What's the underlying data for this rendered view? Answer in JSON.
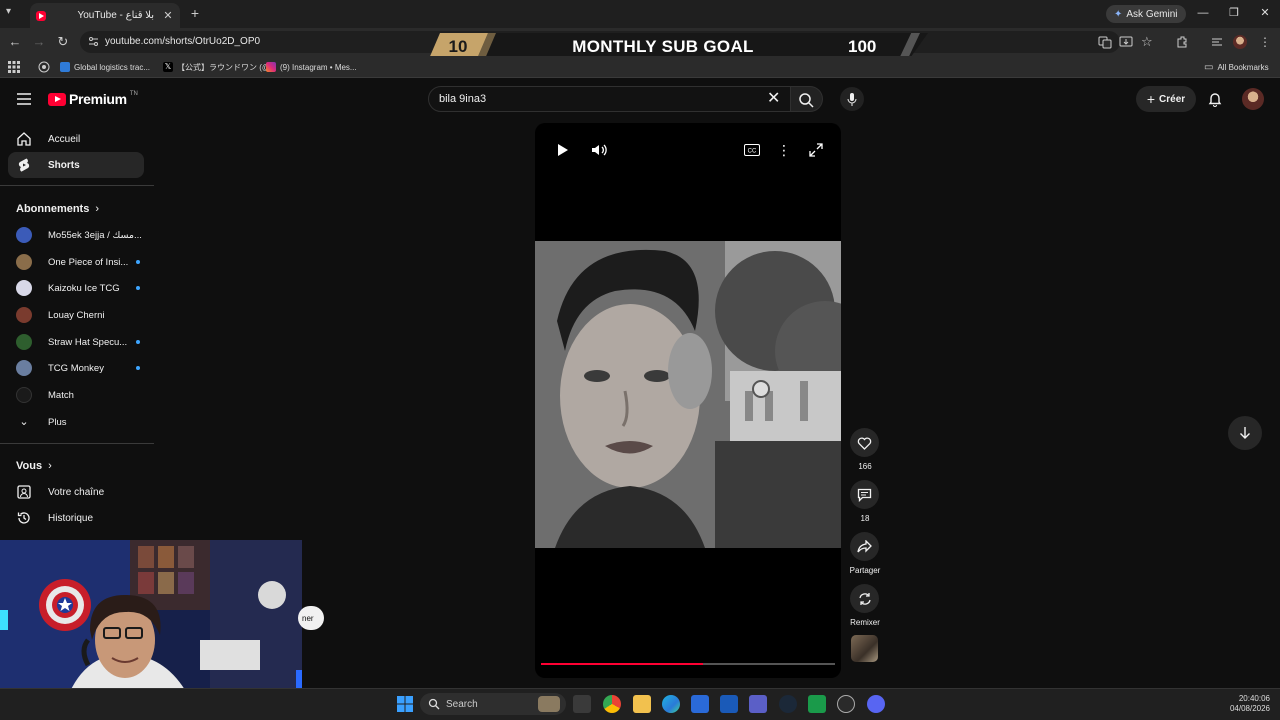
{
  "browser": {
    "tab_title": "YouTube - بلا قناع",
    "tab_close": "✕",
    "new_tab": "+",
    "ask_gemini": "Ask Gemini",
    "url": "youtube.com/shorts/OtrUo2D_OP0",
    "window_controls": [
      "—",
      "❐",
      "✕"
    ],
    "bookmarks": [
      {
        "label": "Global logistics trac...",
        "icon_color": "#2f7bd8"
      },
      {
        "label": "【公式】ラウンドワン (@...",
        "icon_color": "#000000"
      },
      {
        "label": "(9) Instagram • Mes...",
        "icon_color": "#d6249f"
      }
    ],
    "all_bookmarks": "All Bookmarks"
  },
  "overlay": {
    "current": "10",
    "label": "MONTHLY SUB GOAL",
    "target": "100",
    "accent": "#c6a46a"
  },
  "youtube": {
    "logo_text": "Premium",
    "logo_tm": "TN",
    "search_value": "bila 9ina3",
    "create_label": "Créer"
  },
  "sidebar": {
    "main": [
      {
        "label": "Accueil",
        "icon": "home-icon"
      },
      {
        "label": "Shorts",
        "icon": "shorts-icon",
        "active": true
      }
    ],
    "subscriptions_title": "Abonnements",
    "subscriptions": [
      {
        "name": "Mo55ek 3ejja / مسك...",
        "color": "#3b5bb8",
        "dot": false
      },
      {
        "name": "One Piece of Insi...",
        "color": "#8a6d4a",
        "dot": true
      },
      {
        "name": "Kaizoku Ice TCG",
        "color": "#d8d8e8",
        "dot": true
      },
      {
        "name": "Louay Cherni",
        "color": "#7a3b2e",
        "dot": false
      },
      {
        "name": "Straw Hat Specu...",
        "color": "#2e5e2e",
        "dot": true
      },
      {
        "name": "TCG Monkey",
        "color": "#6a7ea0",
        "dot": true
      },
      {
        "name": "Match",
        "color": "#1a1a1a",
        "dot": false
      }
    ],
    "more_label": "Plus",
    "you_title": "Vous",
    "you_items": [
      {
        "label": "Votre chaîne",
        "icon": "your-channel-icon"
      },
      {
        "label": "Historique",
        "icon": "history-icon"
      }
    ]
  },
  "short": {
    "progress": 0.55,
    "likes": "166",
    "comments": "18",
    "share_label": "Partager",
    "remix_label": "Remixer"
  },
  "webcam": {
    "tag": "ner"
  },
  "taskbar": {
    "search_placeholder": "Search",
    "time": "20:40:06",
    "date": "04/08/2026"
  }
}
